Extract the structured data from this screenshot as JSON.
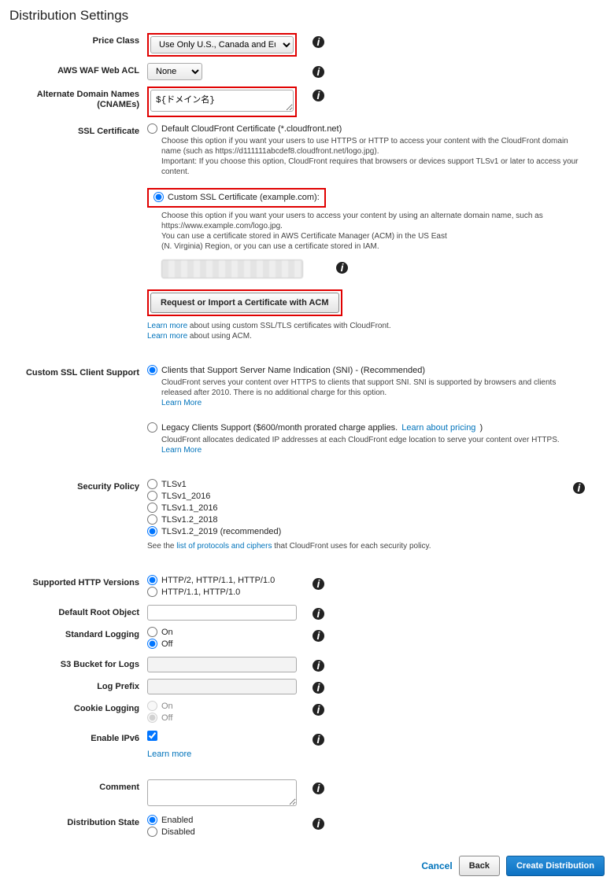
{
  "title": "Distribution Settings",
  "labels": {
    "priceClass": "Price Class",
    "wafAcl": "AWS WAF Web ACL",
    "cnames": "Alternate Domain Names\n(CNAMEs)",
    "cnames_l1": "Alternate Domain Names",
    "cnames_l2": "(CNAMEs)",
    "sslCert": "SSL Certificate",
    "customSslSupport": "Custom SSL Client Support",
    "securityPolicy": "Security Policy",
    "httpVersions": "Supported HTTP Versions",
    "defaultRoot": "Default Root Object",
    "standardLogging": "Standard Logging",
    "s3Bucket": "S3 Bucket for Logs",
    "logPrefix": "Log Prefix",
    "cookieLogging": "Cookie Logging",
    "enableIpv6": "Enable IPv6",
    "comment": "Comment",
    "distState": "Distribution State"
  },
  "priceClass": {
    "selected": "Use Only U.S., Canada and Europe"
  },
  "wafAcl": {
    "selected": "None"
  },
  "cnames": {
    "value": "${ドメイン名}"
  },
  "ssl": {
    "defaultLabel": "Default CloudFront Certificate (*.cloudfront.net)",
    "defaultHelp1": "Choose this option if you want your users to use HTTPS or HTTP to access your content with the CloudFront domain name (such as https://d111111abcdef8.cloudfront.net/logo.jpg).",
    "defaultHelp2": "Important: If you choose this option, CloudFront requires that browsers or devices support TLSv1 or later to access your content.",
    "customLabel": "Custom SSL Certificate (example.com):",
    "customHelp1": "Choose this option if you want your users to access your content by using an alternate domain name, such as https://www.example.com/logo.jpg.",
    "customHelp2": "You can use a certificate stored in AWS Certificate Manager (ACM) in the US East",
    "customHelp3": "(N. Virginia) Region, or you can use a certificate stored in IAM.",
    "requestBtn": "Request or Import a Certificate with ACM",
    "learn1a": "Learn more",
    "learn1b": " about using custom SSL/TLS certificates with CloudFront.",
    "learn2a": "Learn more",
    "learn2b": " about using ACM."
  },
  "sni": {
    "opt1": "Clients that Support Server Name Indication (SNI) - (Recommended)",
    "opt1help": "CloudFront serves your content over HTTPS to clients that support SNI. SNI is supported by browsers and clients released after 2010. There is no additional charge for this option.",
    "learnMore": "Learn More",
    "opt2a": "Legacy Clients Support ($600/month prorated charge applies. ",
    "opt2link": "Learn about pricing",
    "opt2b": ")",
    "opt2help": "CloudFront allocates dedicated IP addresses at each CloudFront edge location to serve your content over HTTPS."
  },
  "secPolicy": {
    "o1": "TLSv1",
    "o2": "TLSv1_2016",
    "o3": "TLSv1.1_2016",
    "o4": "TLSv1.2_2018",
    "o5": "TLSv1.2_2019 (recommended)",
    "helpA": "See the ",
    "helpLink": "list of protocols and ciphers",
    "helpB": " that CloudFront uses for each security policy."
  },
  "http": {
    "o1": "HTTP/2, HTTP/1.1, HTTP/1.0",
    "o2": "HTTP/1.1, HTTP/1.0"
  },
  "logging": {
    "on": "On",
    "off": "Off"
  },
  "cookie": {
    "on": "On",
    "off": "Off"
  },
  "ipv6": {
    "learn": "Learn more"
  },
  "state": {
    "enabled": "Enabled",
    "disabled": "Disabled"
  },
  "footer": {
    "cancel": "Cancel",
    "back": "Back",
    "create": "Create Distribution"
  }
}
